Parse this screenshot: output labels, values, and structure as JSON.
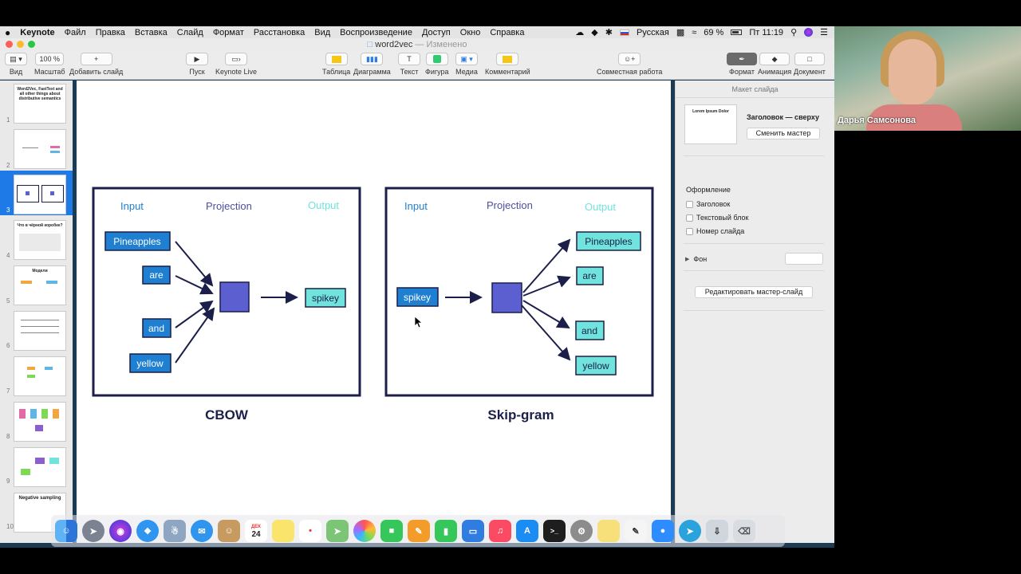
{
  "menubar": {
    "apple": "",
    "app": "Keynote",
    "items": [
      "Файл",
      "Правка",
      "Вставка",
      "Слайд",
      "Формат",
      "Расстановка",
      "Вид",
      "Воспроизведение",
      "Доступ",
      "Окно",
      "Справка"
    ],
    "input_source": "Русская",
    "battery": "69 %",
    "clock": "Пт 11:19"
  },
  "window": {
    "doc_title": "word2vec",
    "doc_status": "— Изменено"
  },
  "toolbar": {
    "view": "Вид",
    "zoom_value": "100 %",
    "zoom": "Масштаб",
    "add_slide": "Добавить слайд",
    "play": "Пуск",
    "keynote_live": "Keynote Live",
    "table": "Таблица",
    "chart": "Диаграмма",
    "text": "Текст",
    "shape": "Фигура",
    "media": "Медиа",
    "comment": "Комментарий",
    "collaborate": "Совместная работа",
    "format": "Формат",
    "animate": "Анимация",
    "document": "Документ",
    "colors": {
      "table": "#f5c518",
      "chart": "#2f7de1",
      "shape": "#2ecc71",
      "comment": "#f5c518"
    }
  },
  "navigator": {
    "slides": [
      {
        "num": "1",
        "title": "Word2Vec, FastText and all other things about distributive semantics"
      },
      {
        "num": "2",
        "title": ""
      },
      {
        "num": "3",
        "title": ""
      },
      {
        "num": "4",
        "title": "Что в чёрной коробке?"
      },
      {
        "num": "5",
        "title": "Модели"
      },
      {
        "num": "6",
        "title": ""
      },
      {
        "num": "7",
        "title": ""
      },
      {
        "num": "8",
        "title": ""
      },
      {
        "num": "9",
        "title": ""
      },
      {
        "num": "10",
        "title": "Negative sampling"
      }
    ],
    "selected": "3"
  },
  "slide": {
    "cbow": {
      "input": "Input",
      "projection": "Projection",
      "output": "Output",
      "words": [
        "Pineapples",
        "are",
        "and",
        "yellow"
      ],
      "target": "spikey",
      "caption": "CBOW"
    },
    "skipgram": {
      "input": "Input",
      "projection": "Projection",
      "output": "Output",
      "source": "spikey",
      "words": [
        "Pineapples",
        "are",
        "and",
        "yellow"
      ],
      "caption": "Skip-gram"
    },
    "colors": {
      "frame": "#1b1f4a",
      "input_box": "#1f7fd1",
      "projection_box": "#5b5fcf",
      "output_box": "#6fe3dc",
      "input_label": "#1f7fd1",
      "projection_label": "#4d4f9e",
      "output_label": "#6fe3dc"
    }
  },
  "inspector": {
    "header": "Макет слайда",
    "master_thumb_text": "Lorem Ipsum Dolor",
    "master_name": "Заголовок — сверху",
    "change_master": "Сменить мастер",
    "appearance": "Оформление",
    "options": [
      "Заголовок",
      "Текстовый блок",
      "Номер слайда"
    ],
    "background": "Фон",
    "edit_master": "Редактировать мастер-слайд"
  },
  "dock": {
    "calendar_month": "ДЕК",
    "calendar_day": "24",
    "apps": [
      "finder-icon",
      "launchpad-icon",
      "siri-icon",
      "safari-icon",
      "preview-icon",
      "messages-icon",
      "contacts-icon",
      "calendar-icon",
      "notes-icon",
      "reminders-icon",
      "maps-icon",
      "photos-icon",
      "facetime-icon",
      "pages-icon",
      "numbers-icon",
      "keynote-icon",
      "music-icon",
      "appstore-icon",
      "terminal-icon",
      "settings-icon",
      "stickies-icon",
      "textedit-icon",
      "zoom-icon",
      "telegram-icon",
      "downloads-icon",
      "trash-icon"
    ]
  },
  "video": {
    "participant": "Дарья Самсонова"
  }
}
